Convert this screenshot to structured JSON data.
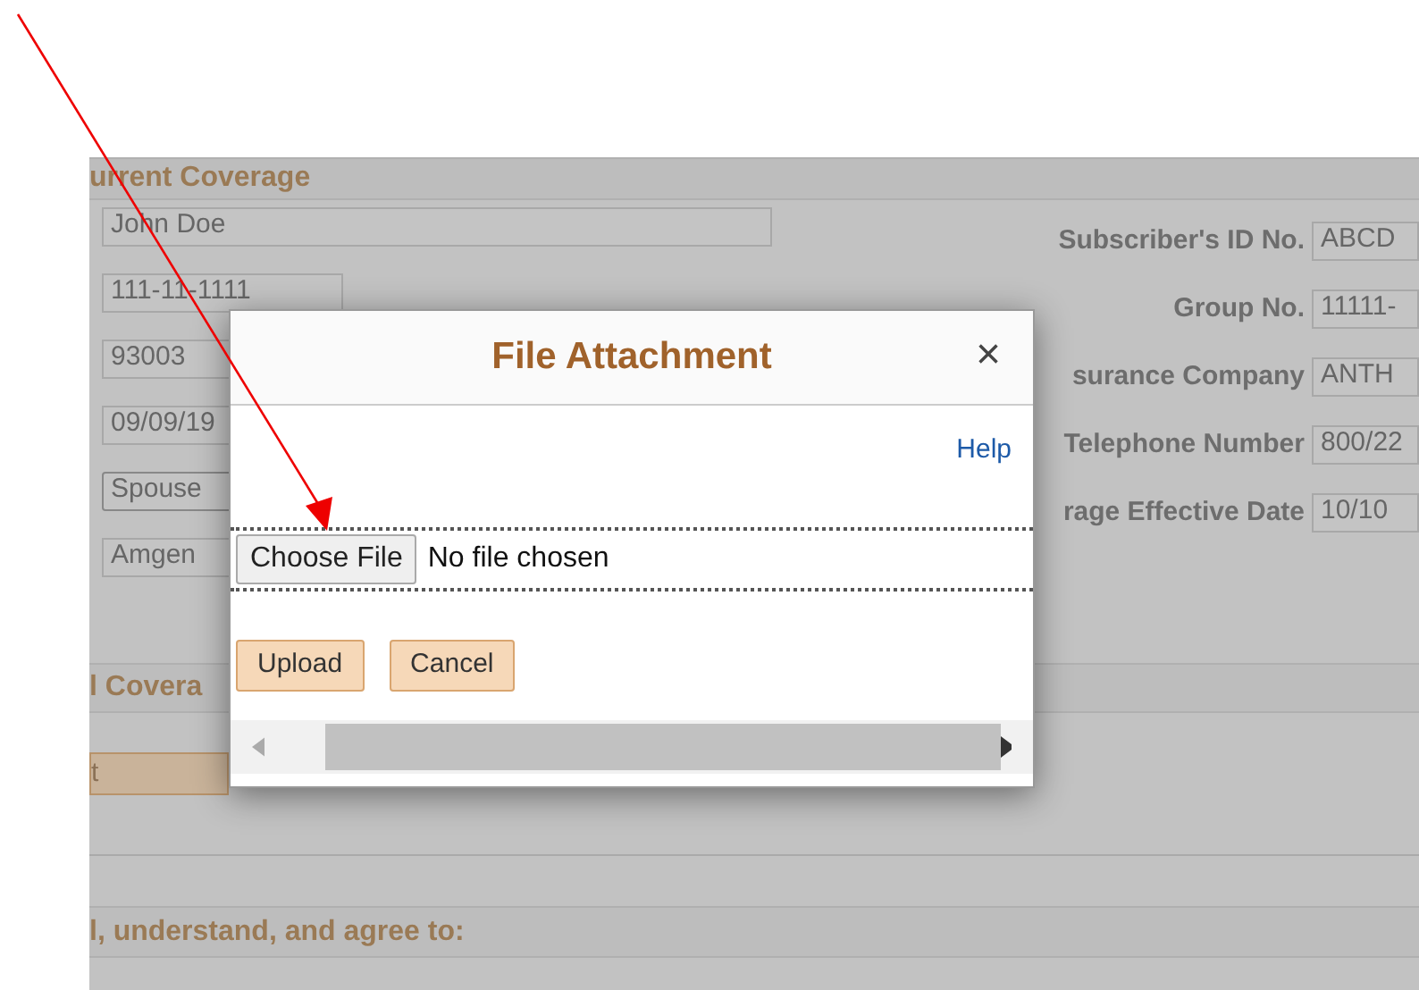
{
  "sections": [
    {
      "title": "urrent Coverage"
    },
    {
      "title": "l Covera"
    },
    {
      "title": "l, understand, and agree to:"
    }
  ],
  "left_fields": [
    {
      "value": "John Doe",
      "kind": "wide"
    },
    {
      "value": "111-11-1111",
      "kind": "mid"
    },
    {
      "value": "93003",
      "kind": "mid"
    },
    {
      "value": "09/09/19",
      "kind": "mid"
    },
    {
      "value": "Spouse",
      "kind": "select"
    },
    {
      "value": "Amgen",
      "kind": "mid"
    }
  ],
  "right_fields": [
    {
      "label": "Subscriber's ID No.",
      "value": "ABCD"
    },
    {
      "label": "Group No.",
      "value": "11111-"
    },
    {
      "label": "surance Company",
      "value": "ANTH"
    },
    {
      "label": "Telephone Number",
      "value": "800/22"
    },
    {
      "label": "rage Effective Date",
      "value": "10/10"
    }
  ],
  "tab_button": "t",
  "dialog": {
    "title": "File Attachment",
    "close": "×",
    "help": "Help",
    "choose_button": "Choose File",
    "file_status": "No file chosen",
    "buttons": [
      "Upload",
      "Cancel"
    ]
  }
}
